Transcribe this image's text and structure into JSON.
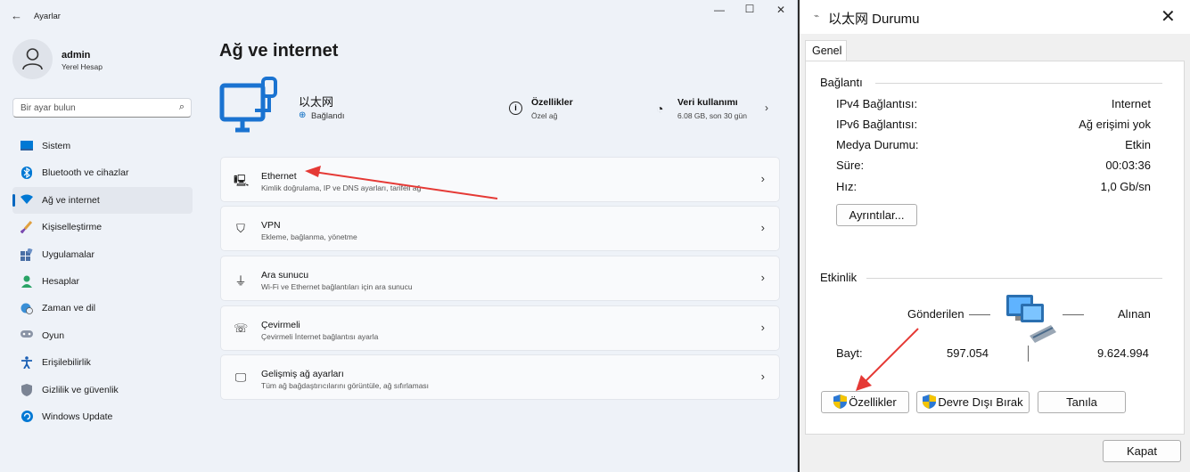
{
  "settings": {
    "app_title": "Ayarlar",
    "user": {
      "name": "admin",
      "account": "Yerel Hesap"
    },
    "search": {
      "placeholder": "Bir ayar bulun"
    },
    "nav": [
      {
        "label": "Sistem",
        "icon": "system-icon"
      },
      {
        "label": "Bluetooth ve cihazlar",
        "icon": "bluetooth-icon"
      },
      {
        "label": "Ağ ve internet",
        "icon": "wifi-icon",
        "active": true
      },
      {
        "label": "Kişiselleştirme",
        "icon": "brush-icon"
      },
      {
        "label": "Uygulamalar",
        "icon": "apps-icon"
      },
      {
        "label": "Hesaplar",
        "icon": "person-icon"
      },
      {
        "label": "Zaman ve dil",
        "icon": "globe-clock-icon"
      },
      {
        "label": "Oyun",
        "icon": "gamepad-icon"
      },
      {
        "label": "Erişilebilirlik",
        "icon": "accessibility-icon"
      },
      {
        "label": "Gizlilik ve güvenlik",
        "icon": "shield-icon"
      },
      {
        "label": "Windows Update",
        "icon": "update-icon"
      }
    ],
    "page_title": "Ağ ve internet",
    "network": {
      "name": "以太网",
      "status": "Bağlandı",
      "properties_title": "Özellikler",
      "properties_sub": "Özel ağ",
      "data_title": "Veri kullanımı",
      "data_sub": "6.08 GB, son 30 gün"
    },
    "cards": [
      {
        "title": "Ethernet",
        "sub": "Kimlik doğrulama, IP ve DNS ayarları, tarifeli ağ",
        "icon": "ethernet-icon"
      },
      {
        "title": "VPN",
        "sub": "Ekleme, bağlanma, yönetme",
        "icon": "vpn-shield-icon"
      },
      {
        "title": "Ara sunucu",
        "sub": "Wi-Fi ve Ethernet bağlantıları için ara sunucu",
        "icon": "proxy-icon"
      },
      {
        "title": "Çevirmeli",
        "sub": "Çevirmeli İnternet bağlantısı ayarla",
        "icon": "dialup-icon"
      },
      {
        "title": "Gelişmiş ağ ayarları",
        "sub": "Tüm ağ bağdaştırıcılarını görüntüle, ağ sıfırlaması",
        "icon": "advanced-network-icon"
      }
    ],
    "accent_color": "#0067c0"
  },
  "dialog": {
    "title": "以太网 Durumu",
    "tab": "Genel",
    "connection_group": "Bağlantı",
    "rows": [
      {
        "label": "IPv4 Bağlantısı:",
        "value": "Internet"
      },
      {
        "label": "IPv6 Bağlantısı:",
        "value": "Ağ erişimi yok"
      },
      {
        "label": "Medya Durumu:",
        "value": "Etkin"
      },
      {
        "label": "Süre:",
        "value": "00:03:36"
      },
      {
        "label": "Hız:",
        "value": "1,0 Gb/sn"
      }
    ],
    "details_button": "Ayrıntılar...",
    "activity_group": "Etkinlik",
    "sent_label": "Gönderilen",
    "received_label": "Alınan",
    "bytes_label": "Bayt:",
    "bytes_sent": "597.054",
    "bytes_received": "9.624.994",
    "properties_button": "Özellikler",
    "disable_button": "Devre Dışı Bırak",
    "diagnose_button": "Tanıla",
    "close_button": "Kapat"
  }
}
